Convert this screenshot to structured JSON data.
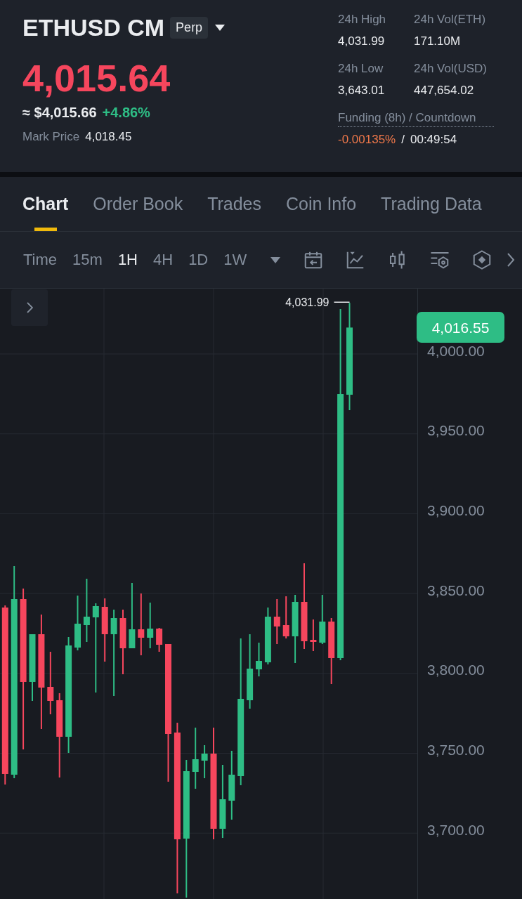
{
  "header": {
    "symbol": "ETHUSD CM",
    "contract_badge": "Perp",
    "last_price": {
      "value": "4,015.64",
      "rising": false
    },
    "approx_price": "≈ $4,015.66",
    "change": {
      "value": "+4.86%",
      "rising": true
    },
    "mark_price": {
      "label": "Mark Price",
      "value": "4,018.45"
    }
  },
  "stats": [
    {
      "label": "24h High",
      "value": "4,031.99"
    },
    {
      "label": "24h Vol(ETH)",
      "value": "171.10M"
    },
    {
      "label": "24h Low",
      "value": "3,643.01"
    },
    {
      "label": "24h Vol(USD)",
      "value": "447,654.02"
    }
  ],
  "funding": {
    "label": "Funding (8h) / Countdown",
    "rate": "-0.00135%",
    "separator": "/",
    "countdown": "00:49:54"
  },
  "tabs": [
    {
      "label": "Chart",
      "selected": true
    },
    {
      "label": "Order Book",
      "selected": false
    },
    {
      "label": "Trades",
      "selected": false
    },
    {
      "label": "Coin Info",
      "selected": false
    },
    {
      "label": "Trading Data",
      "selected": false
    }
  ],
  "intervals": [
    {
      "label": "Time",
      "selected": false
    },
    {
      "label": "15m",
      "selected": false
    },
    {
      "label": "1H",
      "selected": true
    },
    {
      "label": "4H",
      "selected": false
    },
    {
      "label": "1D",
      "selected": false
    },
    {
      "label": "1W",
      "selected": false
    }
  ],
  "chart": {
    "high_marker": "4,031.99",
    "current_price": "4,016.55",
    "chart_data": {
      "type": "candlestick",
      "grid": true,
      "categories": [
        null,
        null,
        null,
        null,
        null,
        null,
        null,
        null,
        null,
        null,
        null,
        null,
        null,
        null,
        null,
        null,
        null,
        null,
        null,
        null,
        null,
        null,
        null,
        null,
        null,
        null,
        null,
        null,
        null,
        null,
        null,
        null,
        null,
        null,
        null,
        null,
        null,
        null,
        null
      ],
      "ohlc": [
        [
          3841.25,
          3842.57,
          3730.43,
          3737.03
        ],
        [
          3736.59,
          3867.19,
          3734.39,
          3846.53
        ],
        [
          3846.53,
          3853.12,
          3752.42,
          3794.64
        ],
        [
          3794.64,
          3824.54,
          3782.76,
          3824.54
        ],
        [
          3824.54,
          3836.85,
          3765.17,
          3791.12
        ],
        [
          3791.56,
          3813.54,
          3774.41,
          3782.76
        ],
        [
          3783.2,
          3787.6,
          3734.83,
          3760.33
        ],
        [
          3760.33,
          3822.78,
          3750.22,
          3817.5
        ],
        [
          3816.18,
          3848.72,
          3814.42,
          3831.13
        ],
        [
          3830.25,
          3859.28,
          3819.7,
          3835.53
        ],
        [
          3835.09,
          3843.89,
          3788.04,
          3842.13
        ],
        [
          3841.69,
          3846.97,
          3807.39,
          3824.54
        ],
        [
          3824.54,
          3839.93,
          3785.84,
          3834.65
        ],
        [
          3834.65,
          3839.93,
          3799.47,
          3815.74
        ],
        [
          3815.74,
          3856.64,
          3815.74,
          3827.62
        ],
        [
          3827.62,
          3850.04,
          3811.35,
          3822.34
        ],
        [
          3822.34,
          3844.33,
          3815.74,
          3828.06
        ],
        [
          3828.06,
          3828.5,
          3813.54,
          3817.94
        ],
        [
          3818.38,
          3818.38,
          3732.19,
          3762.09
        ],
        [
          3762.97,
          3769.13,
          3662.27,
          3696.13
        ],
        [
          3696.57,
          3745.82,
          3659.63,
          3738.79
        ],
        [
          3738.35,
          3766.05,
          3727.79,
          3746.26
        ],
        [
          3745.38,
          3755.06,
          3734.39,
          3749.78
        ],
        [
          3749.78,
          3766.05,
          3696.13,
          3702.73
        ],
        [
          3702.73,
          3742.74,
          3697.01,
          3721.2
        ],
        [
          3720.32,
          3751.54,
          3708.44,
          3736.59
        ],
        [
          3735.71,
          3821.9,
          3729.99,
          3784.08
        ],
        [
          3783.2,
          3824.54,
          3777.93,
          3802.99
        ],
        [
          3802.55,
          3819.26,
          3798.15,
          3807.83
        ],
        [
          3806.95,
          3841.25,
          3805.63,
          3835.53
        ],
        [
          3835.53,
          3846.53,
          3818.38,
          3829.38
        ],
        [
          3830.25,
          3848.28,
          3821.9,
          3823.22
        ],
        [
          3823.22,
          3849.16,
          3806.51,
          3844.77
        ],
        [
          3844.77,
          3868.95,
          3815.3,
          3820.14
        ],
        [
          3821.02,
          3833.77,
          3813.98,
          3819.7
        ],
        [
          3819.26,
          3849.16,
          3818.38,
          3832.45
        ],
        [
          3832.45,
          3834.65,
          3793.32,
          3809.59
        ],
        [
          3809.59,
          4028.14,
          3808.27,
          3974.93
        ],
        [
          3974.49,
          4031.99,
          3964.82,
          4016.55
        ]
      ],
      "ylim": [
        3658.75,
        4040.9
      ],
      "yticks": [
        {
          "value": 4000,
          "label": "4,000.00"
        },
        {
          "value": 3950,
          "label": "3,950.00"
        },
        {
          "value": 3900,
          "label": "3,900.00"
        },
        {
          "value": 3850,
          "label": "3,850.00"
        },
        {
          "value": 3800,
          "label": "3,800.00"
        },
        {
          "value": 3750,
          "label": "3,750.00"
        },
        {
          "value": 3700,
          "label": "3,700.00"
        }
      ]
    }
  }
}
